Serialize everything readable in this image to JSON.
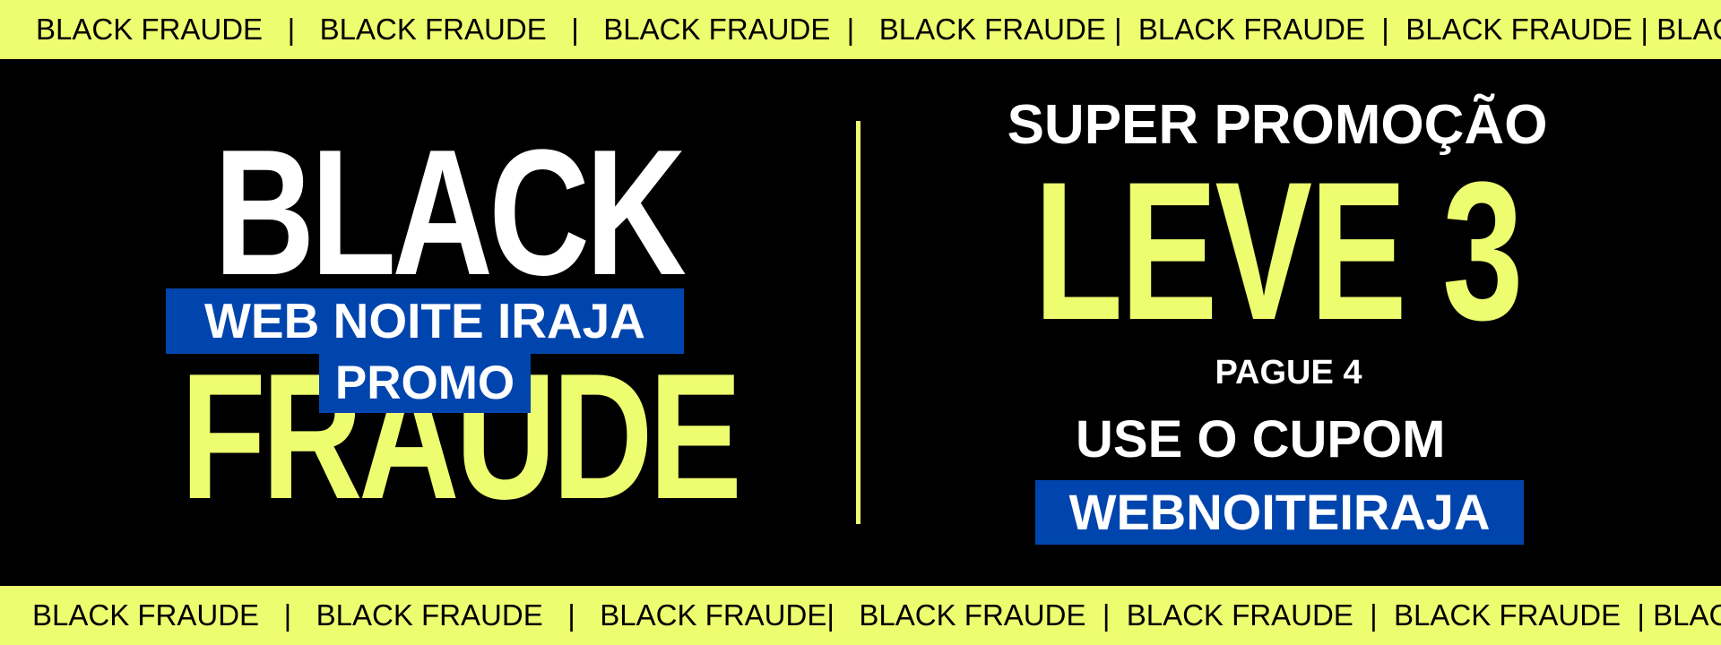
{
  "colors": {
    "background": "#000000",
    "accent_yellow": "#eefc6f",
    "accent_blue": "#0045ad",
    "text_white": "#ffffff"
  },
  "top_strip": {
    "text": "BLACK FRAUDE   |   BLACK FRAUDE   |   BLACK FRAUDE  |   BLACK FRAUDE |  BLACK FRAUDE  |  BLACK FRAUDE | BLACK"
  },
  "bottom_strip": {
    "text": "BLACK FRAUDE   |   BLACK FRAUDE   |   BLACK FRAUDE|   BLACK FRAUDE  |  BLACK FRAUDE  |  BLACK FRAUDE  | BLACK"
  },
  "left": {
    "headline_top": "BLACK",
    "headline_bottom": "FRAUDE",
    "store_name": "WEB NOITE IRAJA",
    "promo_tag": "PROMO"
  },
  "right": {
    "super_promo": "SUPER PROMOÇÃO",
    "offer_main": "LEVE 3",
    "offer_sub": "PAGUE 4",
    "coupon_label": "USE O CUPOM",
    "coupon_code": "WEBNOITEIRAJA"
  }
}
